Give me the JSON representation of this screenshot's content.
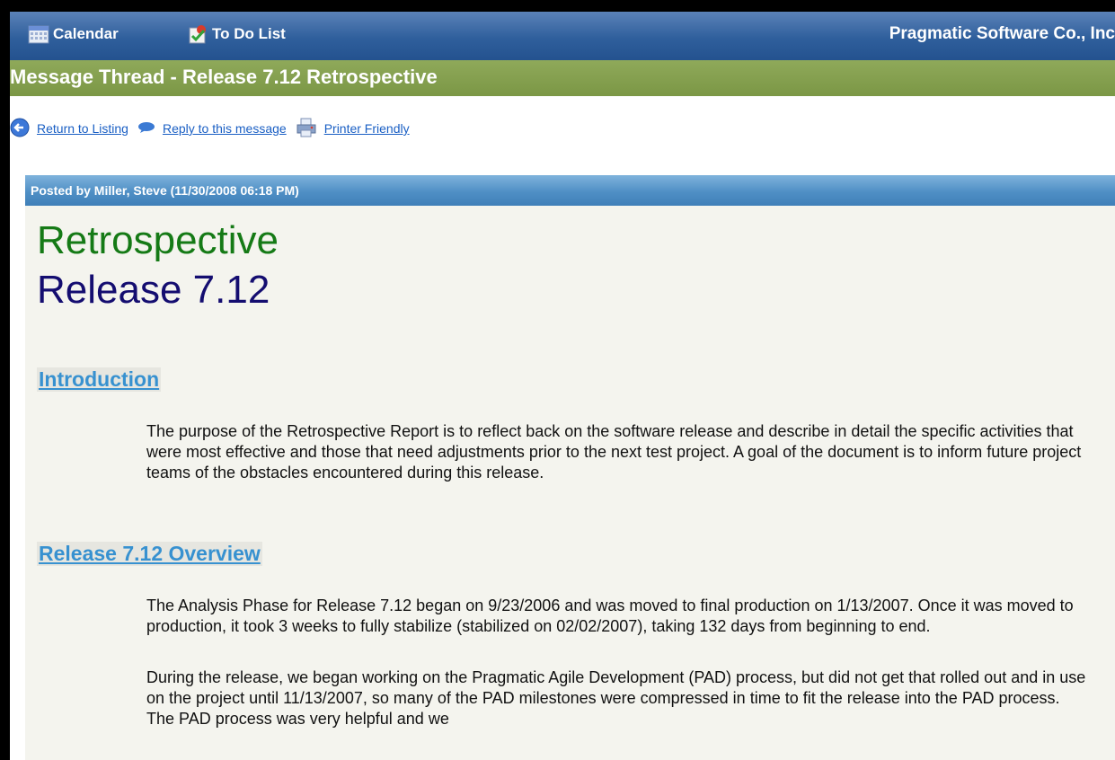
{
  "nav": {
    "calendar_label": "Calendar",
    "calendar_icon": "calendar-icon",
    "todo_label": "To Do List",
    "todo_icon": "todo-list-icon",
    "company": "Pragmatic Software Co., Inc"
  },
  "thread": {
    "title": "Message Thread - Release 7.12 Retrospective"
  },
  "actions": [
    {
      "label": "Return to Listing",
      "icon": "back-arrow-icon"
    },
    {
      "label": "Reply to this message",
      "icon": "reply-bubble-icon"
    },
    {
      "label": "Printer Friendly",
      "icon": "printer-icon"
    }
  ],
  "post": {
    "posted_by": "Posted by Miller, Steve (11/30/2008 06:18 PM)"
  },
  "document": {
    "title_line_1": "Retrospective",
    "title_line_2": "Release 7.12",
    "sections": [
      {
        "heading": "Introduction",
        "paragraphs": [
          "The purpose of the Retrospective Report is to reflect back on the software release and describe in detail the specific activities that were most effective and those that need adjustments prior to the next test project.  A goal of the document is to inform future project teams of the obstacles encountered during this release."
        ]
      },
      {
        "heading": "Release 7.12 Overview",
        "paragraphs": [
          "The Analysis Phase for Release 7.12 began on 9/23/2006 and was moved to final production on 1/13/2007.  Once it was moved to production, it took 3 weeks to fully stabilize (stabilized on 02/02/2007), taking 132 days from beginning to end.",
          "During the release, we began working on the Pragmatic Agile Development (PAD) process, but did not get that rolled out and in use on the project until 11/13/2007, so many of the PAD milestones were compressed in time to fit the release into the PAD process.  The PAD process was very helpful and we"
        ]
      }
    ]
  },
  "colors": {
    "nav_bar": "#2f5f9c",
    "title_bar": "#7b9745",
    "post_bar": "#4f8fc5",
    "doc_title_green": "#157a16",
    "doc_title_navy": "#140d70",
    "section_heading": "#3791d0",
    "link": "#1a5fc4"
  }
}
